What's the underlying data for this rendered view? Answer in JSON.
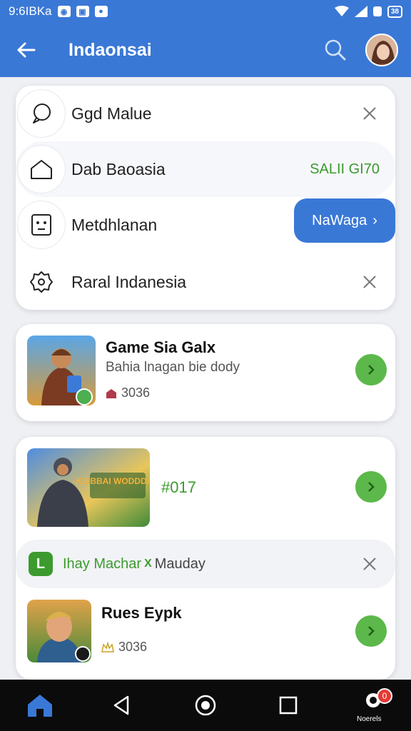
{
  "status_bar": {
    "time": "9:6IBKa",
    "battery": "38"
  },
  "app_bar": {
    "title": "Indaonsai"
  },
  "menu": {
    "rows": [
      {
        "label": "Ggd Malue"
      },
      {
        "label": "Dab Baoasia",
        "value": "SALII GI70"
      },
      {
        "label": "Metdhlanan",
        "button": "NaWaga",
        "button_chevron": "›"
      },
      {
        "label": "Raral Indanesia"
      }
    ]
  },
  "games": [
    {
      "title": "Game Sia Galx",
      "subtitle": "Bahia lnagan bie dody",
      "meta": "3036"
    },
    {
      "code": "#017",
      "banner": "KIEBBAI WODDDAO"
    },
    {
      "title": "Rues Eypk",
      "meta": "3036"
    }
  ],
  "promo": {
    "logo": "L",
    "text1": "Ihay Machar",
    "sep": "X",
    "text2": "Mauday"
  },
  "bottom_nav": {
    "badge": "0",
    "caption": "Noerels"
  },
  "colors": {
    "primary": "#3a78d6",
    "accent_green": "#5cb84a",
    "text_green": "#3c9a2e"
  }
}
